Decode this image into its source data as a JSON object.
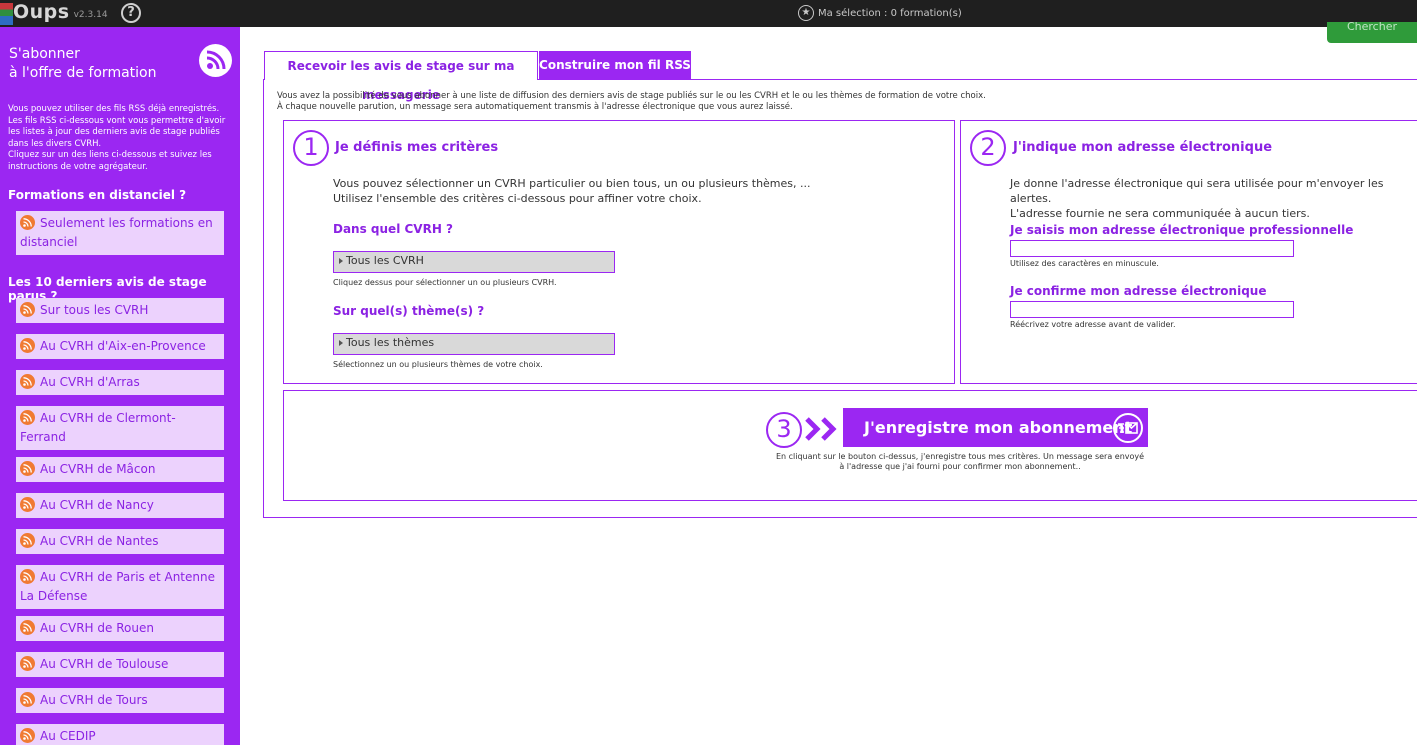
{
  "topbar": {
    "app_name": "Oups",
    "version": "v2.3.14",
    "help_glyph": "?",
    "selection_text": "Ma sélection : 0 formation(s)",
    "search_label": "Chercher"
  },
  "sidebar": {
    "title_line1": "S'abonner",
    "title_line2": "à l'offre de formation",
    "description": [
      "Vous pouvez utiliser des fils RSS déjà enregistrés.",
      "Les fils RSS ci-dessous vont vous permettre d'avoir",
      "les listes à jour des derniers avis de stage publiés",
      "dans les divers CVRH.",
      "Cliquez sur un des liens ci-dessous et suivez les",
      "instructions de votre agrégateur."
    ],
    "section_distanciel": "Formations en distanciel ?",
    "distanciel_items": [
      "Seulement les formations en distanciel"
    ],
    "section_derniers": "Les 10 derniers avis de stage parus ?",
    "derniers_items": [
      "Sur tous les CVRH",
      "Au CVRH d'Aix-en-Provence",
      "Au CVRH d'Arras",
      "Au CVRH de Clermont-Ferrand",
      "Au CVRH de Mâcon",
      "Au CVRH de Nancy",
      "Au CVRH de Nantes",
      "Au CVRH de Paris et Antenne La Défense",
      "Au CVRH de Rouen",
      "Au CVRH de Toulouse",
      "Au CVRH de Tours",
      "Au CEDIP"
    ]
  },
  "tabs": {
    "email": "Recevoir les avis de stage sur ma messagerie",
    "rss": "Construire mon fil RSS"
  },
  "intro": [
    "Vous avez la possibilité de vous abonner à une liste de diffusion des derniers avis de stage publiés sur le ou les CVRH et le ou les thèmes de formation de votre choix.",
    "À chaque nouvelle parution, un message sera automatiquement transmis à l'adresse électronique que vous aurez laissé."
  ],
  "step1": {
    "number": "1",
    "title": "Je définis mes critères",
    "text_line1": "Vous pouvez sélectionner un CVRH particulier ou bien tous, un ou plusieurs thèmes, ...",
    "text_line2": "Utilisez l'ensemble des critères ci-dessous pour affiner votre choix.",
    "cvrh_label": "Dans quel CVRH ?",
    "cvrh_value": "Tous les CVRH",
    "cvrh_hint": "Cliquez dessus pour sélectionner un ou plusieurs CVRH.",
    "theme_label": "Sur quel(s) thème(s) ?",
    "theme_value": "Tous les thèmes",
    "theme_hint": "Sélectionnez un ou plusieurs thèmes de votre choix."
  },
  "step2": {
    "number": "2",
    "title": "J'indique mon adresse électronique",
    "text_line1": "Je donne l'adresse électronique qui sera utilisée pour m'envoyer les alertes.",
    "text_line2": "L'adresse fournie ne sera communiquée à aucun tiers.",
    "email_label": "Je saisis mon adresse électronique professionnelle",
    "email_hint": "Utilisez des caractères en minuscule.",
    "confirm_label": "Je confirme mon adresse électronique",
    "confirm_hint": "Réécrivez votre adresse avant de valider."
  },
  "step3": {
    "number": "3",
    "button_label": "J'enregistre mon abonnement",
    "note_line1": "En cliquant sur le bouton ci-dessus, j'enregistre tous mes critères. Un message sera envoyé",
    "note_line2": "à l'adresse que j'ai fourni pour confirmer mon abonnement.."
  },
  "colors": {
    "accent": "#9b27f2",
    "sidebar_item_bg": "#ecd2fd",
    "rss_orange": "#f07a33",
    "topbar": "#1f1f1f",
    "search_green": "#2f9b3a"
  }
}
